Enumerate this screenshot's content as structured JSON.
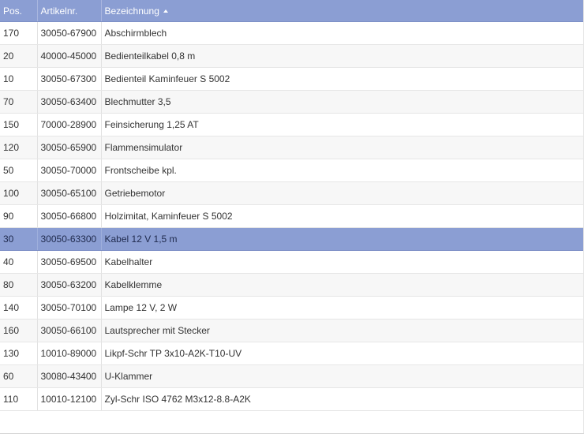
{
  "grid": {
    "columns": [
      {
        "label": "Pos."
      },
      {
        "label": "Artikelnr."
      },
      {
        "label": "Bezeichnung",
        "sort_icon": "sort-ascending-icon"
      }
    ],
    "rows": [
      {
        "pos": "170",
        "artikelnr": "30050-67900",
        "bezeichnung": "Abschirmblech"
      },
      {
        "pos": "20",
        "artikelnr": "40000-45000",
        "bezeichnung": "Bedienteilkabel 0,8 m"
      },
      {
        "pos": "10",
        "artikelnr": "30050-67300",
        "bezeichnung": "Bedienteil Kaminfeuer S 5002"
      },
      {
        "pos": "70",
        "artikelnr": "30050-63400",
        "bezeichnung": "Blechmutter 3,5"
      },
      {
        "pos": "150",
        "artikelnr": "70000-28900",
        "bezeichnung": "Feinsicherung 1,25 AT"
      },
      {
        "pos": "120",
        "artikelnr": "30050-65900",
        "bezeichnung": "Flammensimulator"
      },
      {
        "pos": "50",
        "artikelnr": "30050-70000",
        "bezeichnung": "Frontscheibe kpl."
      },
      {
        "pos": "100",
        "artikelnr": "30050-65100",
        "bezeichnung": "Getriebemotor"
      },
      {
        "pos": "90",
        "artikelnr": "30050-66800",
        "bezeichnung": "Holzimitat, Kaminfeuer S 5002"
      },
      {
        "pos": "30",
        "artikelnr": "30050-63300",
        "bezeichnung": "Kabel 12 V 1,5 m",
        "selected": true
      },
      {
        "pos": "40",
        "artikelnr": "30050-69500",
        "bezeichnung": "Kabelhalter"
      },
      {
        "pos": "80",
        "artikelnr": "30050-63200",
        "bezeichnung": "Kabelklemme"
      },
      {
        "pos": "140",
        "artikelnr": "30050-70100",
        "bezeichnung": "Lampe 12 V, 2 W"
      },
      {
        "pos": "160",
        "artikelnr": "30050-66100",
        "bezeichnung": "Lautsprecher mit Stecker"
      },
      {
        "pos": "130",
        "artikelnr": "10010-89000",
        "bezeichnung": "Likpf-Schr TP 3x10-A2K-T10-UV"
      },
      {
        "pos": "60",
        "artikelnr": "30080-43400",
        "bezeichnung": "U-Klammer"
      },
      {
        "pos": "110",
        "artikelnr": "10010-12100",
        "bezeichnung": "Zyl-Schr ISO 4762 M3x12-8.8-A2K"
      }
    ]
  },
  "colors": {
    "header_bg": "#8b9ed3",
    "selected_row_bg": "#8b9ed3",
    "stripe_bg": "#f7f7f7"
  }
}
